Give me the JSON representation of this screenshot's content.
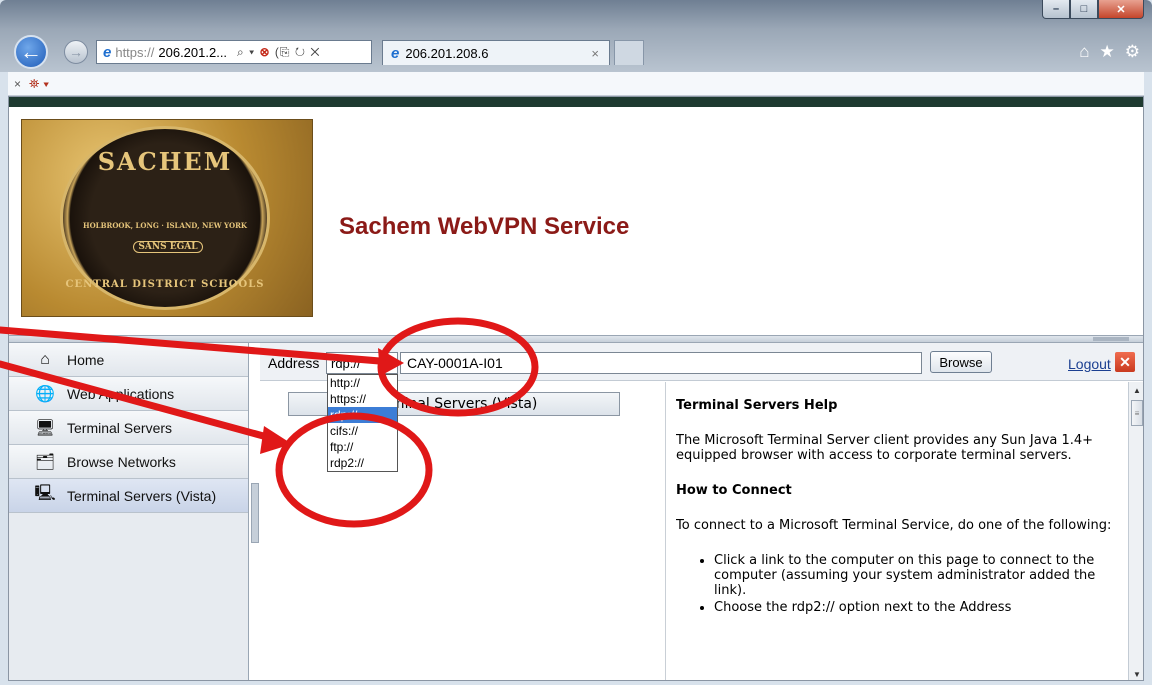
{
  "browser": {
    "url_dim": "https://",
    "url_host": "206.201.2...",
    "addr_tools": "⌕ ▾",
    "tab_title": "206.201.208.6",
    "tab_close": "×",
    "back_glyph": "←",
    "fwd_glyph": "→",
    "win_min": "–",
    "win_max": "□",
    "win_close": "✕",
    "icons": [
      "home-icon",
      "favorites-star-icon",
      "settings-gear-icon"
    ]
  },
  "cmdbar": {
    "close": "×",
    "compat": "⛯ ▾"
  },
  "header": {
    "title": "Sachem WebVPN Service",
    "seal_top": "SACHEM",
    "seal_mid": "HOLBROOK, LONG · ISLAND, NEW YORK",
    "seal_motto": "SANS EGAL",
    "seal_bottom": "CENTRAL DISTRICT SCHOOLS"
  },
  "sidebar": {
    "items": [
      {
        "label": "Home",
        "icon": "home-icon"
      },
      {
        "label": "Web Applications",
        "icon": "web-applications-icon"
      },
      {
        "label": "Terminal Servers",
        "icon": "terminal-servers-icon"
      },
      {
        "label": "Browse Networks",
        "icon": "browse-networks-icon"
      },
      {
        "label": "Terminal Servers (Vista)",
        "icon": "terminal-servers-vista-icon"
      }
    ]
  },
  "toolbar": {
    "address_label": "Address",
    "protocol_value": "rdp://",
    "host_value": "CAY-0001A-I01",
    "browse_label": "Browse",
    "logout_label": "Logout",
    "logout_x": "✕"
  },
  "protocols": [
    "http://",
    "https://",
    "rdp://",
    "cifs://",
    "ftp://",
    "rdp2://"
  ],
  "selected_protocol_index": 2,
  "pane": {
    "tab_label": "Terminal Servers (Vista)"
  },
  "help": {
    "title": "Terminal Servers Help",
    "intro": "The Microsoft Terminal Server client provides any Sun Java 1.4+ equipped browser with access to corporate terminal servers.",
    "how_heading": "How to Connect",
    "how_text": "To connect to a Microsoft Terminal Service, do one of the following:",
    "bullets": [
      "Click a link to the computer on this page to connect to the computer (assuming your system administrator added the link).",
      "Choose the rdp2:// option next to the Address"
    ]
  },
  "colors": {
    "title": "#8b1a17",
    "annotation": "#e01818",
    "selection": "#3c7dd6"
  }
}
